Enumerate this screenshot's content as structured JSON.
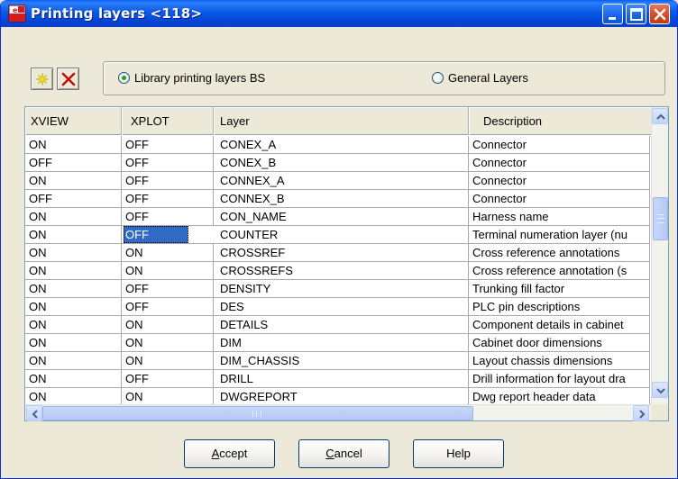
{
  "window": {
    "title": "Printing layers <118>",
    "app_icon": "app-document-icon",
    "controls": [
      "minimize-icon",
      "maximize-icon",
      "close-icon"
    ]
  },
  "toolbar": {
    "new_icon": "new-layer-star-icon",
    "delete_icon": "delete-x-icon"
  },
  "radio_group": {
    "options": [
      {
        "label": "Library printing layers BS",
        "selected": true
      },
      {
        "label": "General Layers",
        "selected": false
      }
    ]
  },
  "table": {
    "columns": [
      "XVIEW",
      "XPLOT",
      "Layer",
      "Description"
    ],
    "rows": [
      {
        "xview": "ON",
        "xplot": "OFF",
        "layer": "CONEX_A",
        "description": "Connector"
      },
      {
        "xview": "OFF",
        "xplot": "OFF",
        "layer": "CONEX_B",
        "description": "Connector"
      },
      {
        "xview": "ON",
        "xplot": "OFF",
        "layer": "CONNEX_A",
        "description": "Connector"
      },
      {
        "xview": "OFF",
        "xplot": "OFF",
        "layer": "CONNEX_B",
        "description": "Connector"
      },
      {
        "xview": "ON",
        "xplot": "OFF",
        "layer": "CON_NAME",
        "description": "Harness name"
      },
      {
        "xview": "ON",
        "xplot": "OFF",
        "layer": "COUNTER",
        "description": "Terminal numeration layer (nu"
      },
      {
        "xview": "ON",
        "xplot": "ON",
        "layer": "CROSSREF",
        "description": "Cross reference annotations"
      },
      {
        "xview": "ON",
        "xplot": "ON",
        "layer": "CROSSREFS",
        "description": "Cross reference annotation (s"
      },
      {
        "xview": "ON",
        "xplot": "OFF",
        "layer": "DENSITY",
        "description": "Trunking fill factor"
      },
      {
        "xview": "ON",
        "xplot": "OFF",
        "layer": "DES",
        "description": "PLC pin descriptions"
      },
      {
        "xview": "ON",
        "xplot": "ON",
        "layer": "DETAILS",
        "description": "Component details in cabinet"
      },
      {
        "xview": "ON",
        "xplot": "ON",
        "layer": "DIM",
        "description": "Cabinet door dimensions"
      },
      {
        "xview": "ON",
        "xplot": "ON",
        "layer": "DIM_CHASSIS",
        "description": "Layout chassis dimensions"
      },
      {
        "xview": "ON",
        "xplot": "OFF",
        "layer": "DRILL",
        "description": "Drill information for layout dra"
      },
      {
        "xview": "ON",
        "xplot": "ON",
        "layer": "DWGREPORT",
        "description": "Dwg report header data"
      }
    ],
    "selected_cell": {
      "row": 5,
      "column": "xplot"
    },
    "selection_color": "#316ac5"
  },
  "buttons": {
    "accept": {
      "mnemonic": "A",
      "rest": "ccept"
    },
    "cancel": {
      "mnemonic": "C",
      "rest": "ancel"
    },
    "help": "Help"
  },
  "colors": {
    "title_bar": "#0b59e6",
    "dialog_bg": "#ece9d8",
    "close_button": "#d4481f"
  }
}
